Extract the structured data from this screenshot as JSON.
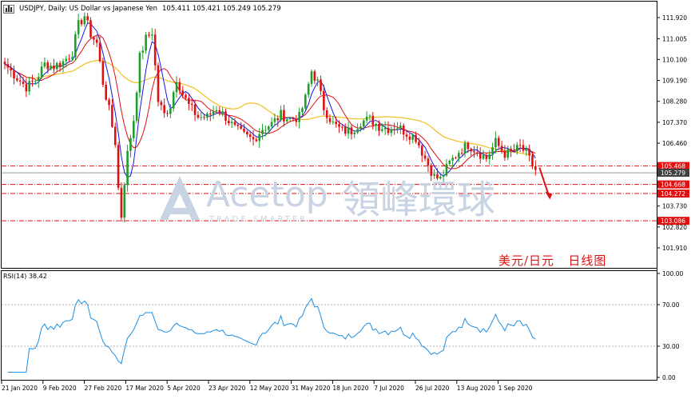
{
  "header": {
    "symbol_info": "USDJPY, Daily:  US Dollar vs Japanese Yen",
    "ohlc": "105.411 105.421 105.249 105.279"
  },
  "watermark": {
    "brand_latin": "Acetop",
    "brand_cn": "領峰環球",
    "tagline": "TRADE SMARTER"
  },
  "annotation": {
    "cn_title": "美元/日元   日线图",
    "arrow_color": "#e01010"
  },
  "price_axis": {
    "ticks": [
      "111.920",
      "111.005",
      "110.100",
      "109.190",
      "108.280",
      "107.370",
      "106.460",
      "103.730",
      "102.820",
      "101.910"
    ]
  },
  "levels": [
    {
      "value": "105.468",
      "kind": "resistance",
      "color": "#e01010"
    },
    {
      "value": "105.279",
      "kind": "current",
      "color": "#404040"
    },
    {
      "value": "104.668",
      "kind": "support",
      "color": "#e01010"
    },
    {
      "value": "104.272",
      "kind": "support",
      "color": "#e01010"
    },
    {
      "value": "103.086",
      "kind": "support",
      "color": "#e01010"
    }
  ],
  "rsi": {
    "label": "RSI(14) 38.42",
    "ticks": [
      "100.00",
      "70.00",
      "30.00",
      "0.00"
    ],
    "color": "#1e8fe0"
  },
  "time_axis": {
    "labels": [
      "21 Jan 2020",
      "9 Feb 2020",
      "27 Feb 2020",
      "17 Mar 2020",
      "5 Apr 2020",
      "23 Apr 2020",
      "12 May 2020",
      "31 May 2020",
      "18 Jun 2020",
      "7 Jul 2020",
      "26 Jul 2020",
      "13 Aug 2020",
      "1 Sep 2020"
    ]
  },
  "colors": {
    "bull": "#1f9e2c",
    "bear": "#e01010",
    "ma_fast": "#1515e6",
    "ma_mid": "#e01010",
    "ma_slow": "#f0c020"
  },
  "chart_data": {
    "type": "candlestick",
    "instrument": "USDJPY",
    "timeframe": "Daily",
    "ylim": [
      101.6,
      112.4
    ],
    "anchors": [
      [
        0,
        109.9
      ],
      [
        4,
        109.3
      ],
      [
        7,
        108.9
      ],
      [
        10,
        109.2
      ],
      [
        13,
        109.9
      ],
      [
        16,
        109.8
      ],
      [
        19,
        110.0
      ],
      [
        22,
        110.4
      ],
      [
        24,
        111.6
      ],
      [
        26,
        112.0
      ],
      [
        28,
        111.2
      ],
      [
        30,
        110.8
      ],
      [
        32,
        109.1
      ],
      [
        34,
        107.9
      ],
      [
        36,
        106.5
      ],
      [
        37,
        104.5
      ],
      [
        38,
        103.3
      ],
      [
        39,
        104.8
      ],
      [
        40,
        106.0
      ],
      [
        42,
        107.5
      ],
      [
        44,
        110.2
      ],
      [
        46,
        111.0
      ],
      [
        48,
        111.3
      ],
      [
        49,
        109.8
      ],
      [
        50,
        108.3
      ],
      [
        52,
        107.7
      ],
      [
        54,
        108.1
      ],
      [
        56,
        109.3
      ],
      [
        58,
        108.6
      ],
      [
        60,
        108.1
      ],
      [
        63,
        107.6
      ],
      [
        66,
        107.6
      ],
      [
        69,
        108.0
      ],
      [
        72,
        107.6
      ],
      [
        75,
        107.1
      ],
      [
        78,
        106.8
      ],
      [
        81,
        106.6
      ],
      [
        84,
        107.1
      ],
      [
        87,
        107.3
      ],
      [
        90,
        107.7
      ],
      [
        93,
        107.5
      ],
      [
        96,
        107.6
      ],
      [
        98,
        108.4
      ],
      [
        100,
        109.6
      ],
      [
        102,
        109.1
      ],
      [
        104,
        108.0
      ],
      [
        107,
        107.3
      ],
      [
        110,
        107.0
      ],
      [
        113,
        107.0
      ],
      [
        116,
        107.4
      ],
      [
        119,
        107.5
      ],
      [
        122,
        107.2
      ],
      [
        125,
        107.1
      ],
      [
        128,
        107.2
      ],
      [
        131,
        106.9
      ],
      [
        134,
        106.7
      ],
      [
        137,
        105.8
      ],
      [
        140,
        105.0
      ],
      [
        142,
        104.9
      ],
      [
        145,
        105.6
      ],
      [
        148,
        106.1
      ],
      [
        151,
        106.4
      ],
      [
        154,
        106.1
      ],
      [
        157,
        105.8
      ],
      [
        160,
        106.5
      ],
      [
        163,
        106.0
      ],
      [
        166,
        106.1
      ],
      [
        168,
        106.3
      ],
      [
        170,
        106.0
      ],
      [
        172,
        105.5
      ],
      [
        173,
        105.3
      ]
    ]
  }
}
